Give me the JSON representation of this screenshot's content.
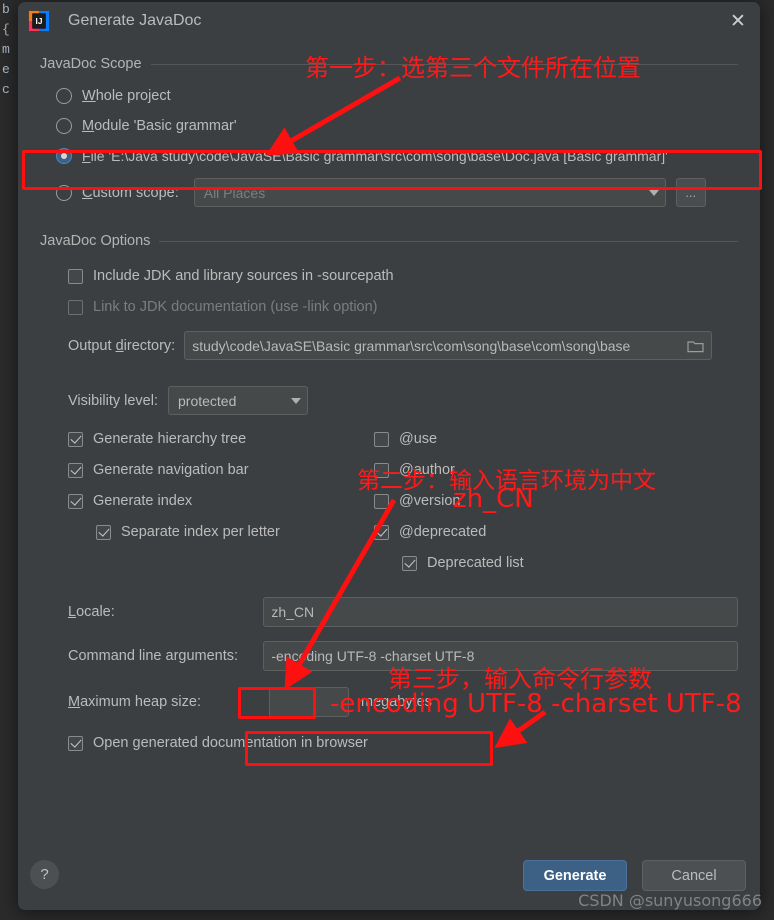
{
  "window": {
    "title": "Generate JavaDoc",
    "app_icon": "intellij-idea-icon",
    "close_icon": "close-icon"
  },
  "scope": {
    "group_label": "JavaDoc Scope",
    "options": [
      {
        "label_pre": "W",
        "label": "hole project",
        "selected": false,
        "name": "whole-project"
      },
      {
        "label_pre": "M",
        "label": "odule 'Basic grammar'",
        "selected": false,
        "name": "module"
      },
      {
        "label_pre": "F",
        "label": "ile 'E:\\Java study\\code\\JavaSE\\Basic grammar\\src\\com\\song\\base\\Doc.java [Basic grammar]'",
        "selected": true,
        "name": "file"
      },
      {
        "label_pre": "C",
        "label": "ustom scope:",
        "selected": false,
        "name": "custom-scope"
      }
    ],
    "custom_scope_value": "All Places",
    "custom_scope_browse": "...",
    "dropdown_icon": "chevron-down-icon"
  },
  "options": {
    "group_label": "JavaDoc Options",
    "include_jdk": {
      "label": "Include JDK and library sources in -sourcepath",
      "checked": false
    },
    "link_jdk": {
      "label": "Link to JDK documentation (use -link option)",
      "checked": false,
      "disabled": true
    },
    "output_dir_label_pre": "Output ",
    "output_dir_label_mn": "d",
    "output_dir_label_post": "irectory:",
    "output_dir_value": "study\\code\\JavaSE\\Basic grammar\\src\\com\\song\\base\\com\\song\\base",
    "folder_icon": "folder-icon"
  },
  "visibility": {
    "label": "Visibility level:",
    "value": "protected",
    "dropdown_icon": "chevron-down-icon"
  },
  "left_checks": [
    {
      "label": "Generate hierarchy tree",
      "checked": true,
      "indent": 0,
      "name": "generate-hierarchy-tree"
    },
    {
      "label": "Generate navigation bar",
      "checked": true,
      "indent": 0,
      "name": "generate-navigation-bar"
    },
    {
      "label": "Generate index",
      "checked": true,
      "indent": 0,
      "name": "generate-index"
    },
    {
      "label": "Separate index per letter",
      "checked": true,
      "indent": 1,
      "name": "separate-index-per-letter"
    }
  ],
  "right_checks": [
    {
      "label": "@use",
      "checked": false,
      "indent": 0,
      "name": "tag-use"
    },
    {
      "label": "@author",
      "checked": false,
      "indent": 0,
      "name": "tag-author"
    },
    {
      "label": "@version",
      "checked": false,
      "indent": 0,
      "name": "tag-version"
    },
    {
      "label": "@deprecated",
      "checked": true,
      "indent": 0,
      "name": "tag-deprecated"
    },
    {
      "label": "Deprecated list",
      "checked": true,
      "indent": 1,
      "name": "deprecated-list"
    }
  ],
  "locale": {
    "label_pre": "L",
    "label": "ocale:",
    "value": "zh_CN"
  },
  "cmdline": {
    "label": "Command line arguments:",
    "value": "-encoding UTF-8 -charset UTF-8"
  },
  "heap": {
    "label_pre": "M",
    "label": "aximum heap size:",
    "value": "",
    "unit": "megabytes"
  },
  "open_browser": {
    "label": "Open generated documentation in browser",
    "checked": true
  },
  "footer": {
    "help_label": "?",
    "generate_label": "Generate",
    "cancel_label": "Cancel",
    "watermark": "CSDN @sunyusong666"
  },
  "annotations": {
    "step1": "第一步：选第三个文件所在位置",
    "step2": "第二步：输入语言环境为中文",
    "step2b": "zh_CN",
    "step3": "第三步，输入命令行参数",
    "step3b": "-encoding UTF-8 -charset UTF-8",
    "color": "#ff1a1a"
  },
  "editor_backdrop": {
    "glyphs": [
      "b",
      "",
      "",
      "",
      "",
      "",
      "",
      "",
      "",
      "",
      "{",
      "",
      "",
      "",
      "",
      "",
      "",
      "",
      "",
      "m",
      "e",
      "",
      "c",
      "",
      "",
      "",
      "",
      "",
      "",
      "",
      "",
      "",
      "",
      "",
      "",
      "",
      "",
      "",
      "",
      "",
      "",
      "",
      "",
      "",
      "",
      ""
    ]
  }
}
